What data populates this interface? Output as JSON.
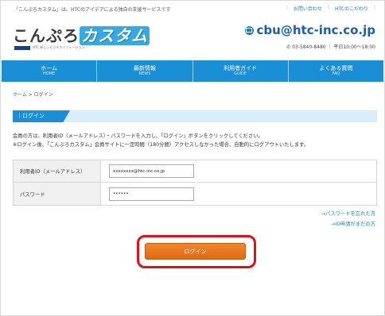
{
  "header": {
    "tagline": "「こんぷろカスタム」は、HTCのアイデアによる独自の支援サービスです",
    "top_links": [
      "お問い合わせ",
      "HTCのこだわり"
    ],
    "logo_text_main": "こんぷろ",
    "logo_text_accent": "カスタム",
    "logo_sub": "HTC 新しいビジネスソリューション",
    "email": "cbu@htc-inc.co.jp",
    "phone": "03-5840-8480 ｜ 平日10:00～18:00"
  },
  "nav": [
    {
      "jp": "ホーム",
      "en": "HOME"
    },
    {
      "jp": "最新情報",
      "en": "NEWS"
    },
    {
      "jp": "利用者ガイド",
      "en": "GUIDE"
    },
    {
      "jp": "よくある質問",
      "en": "FAQ"
    }
  ],
  "breadcrumb": {
    "home": "ホーム",
    "sep": " > ",
    "current": "ログイン"
  },
  "section": {
    "title": "ログイン"
  },
  "description": {
    "line1": "会員の方は、利用者ID（メールアドレス）・パスワードを入力し、「ログイン」ボタンをクリックしてください。",
    "line2": "※ログイン後、「こんぷろカスタム」会員サイトに一定時間（180分間）アクセスしなかった場合、自動的にログアウトいたします。"
  },
  "form": {
    "user_id_label": "利用者ID（メールアドレス）",
    "user_id_value": "xxxxxxxx@htc-inc.co.jp",
    "password_label": "パスワード",
    "password_value": "••••••"
  },
  "links": {
    "forgot_password": "→パスワードを忘れた方",
    "id_request": "→ID申請がまだの方"
  },
  "login_button": "ログイン"
}
